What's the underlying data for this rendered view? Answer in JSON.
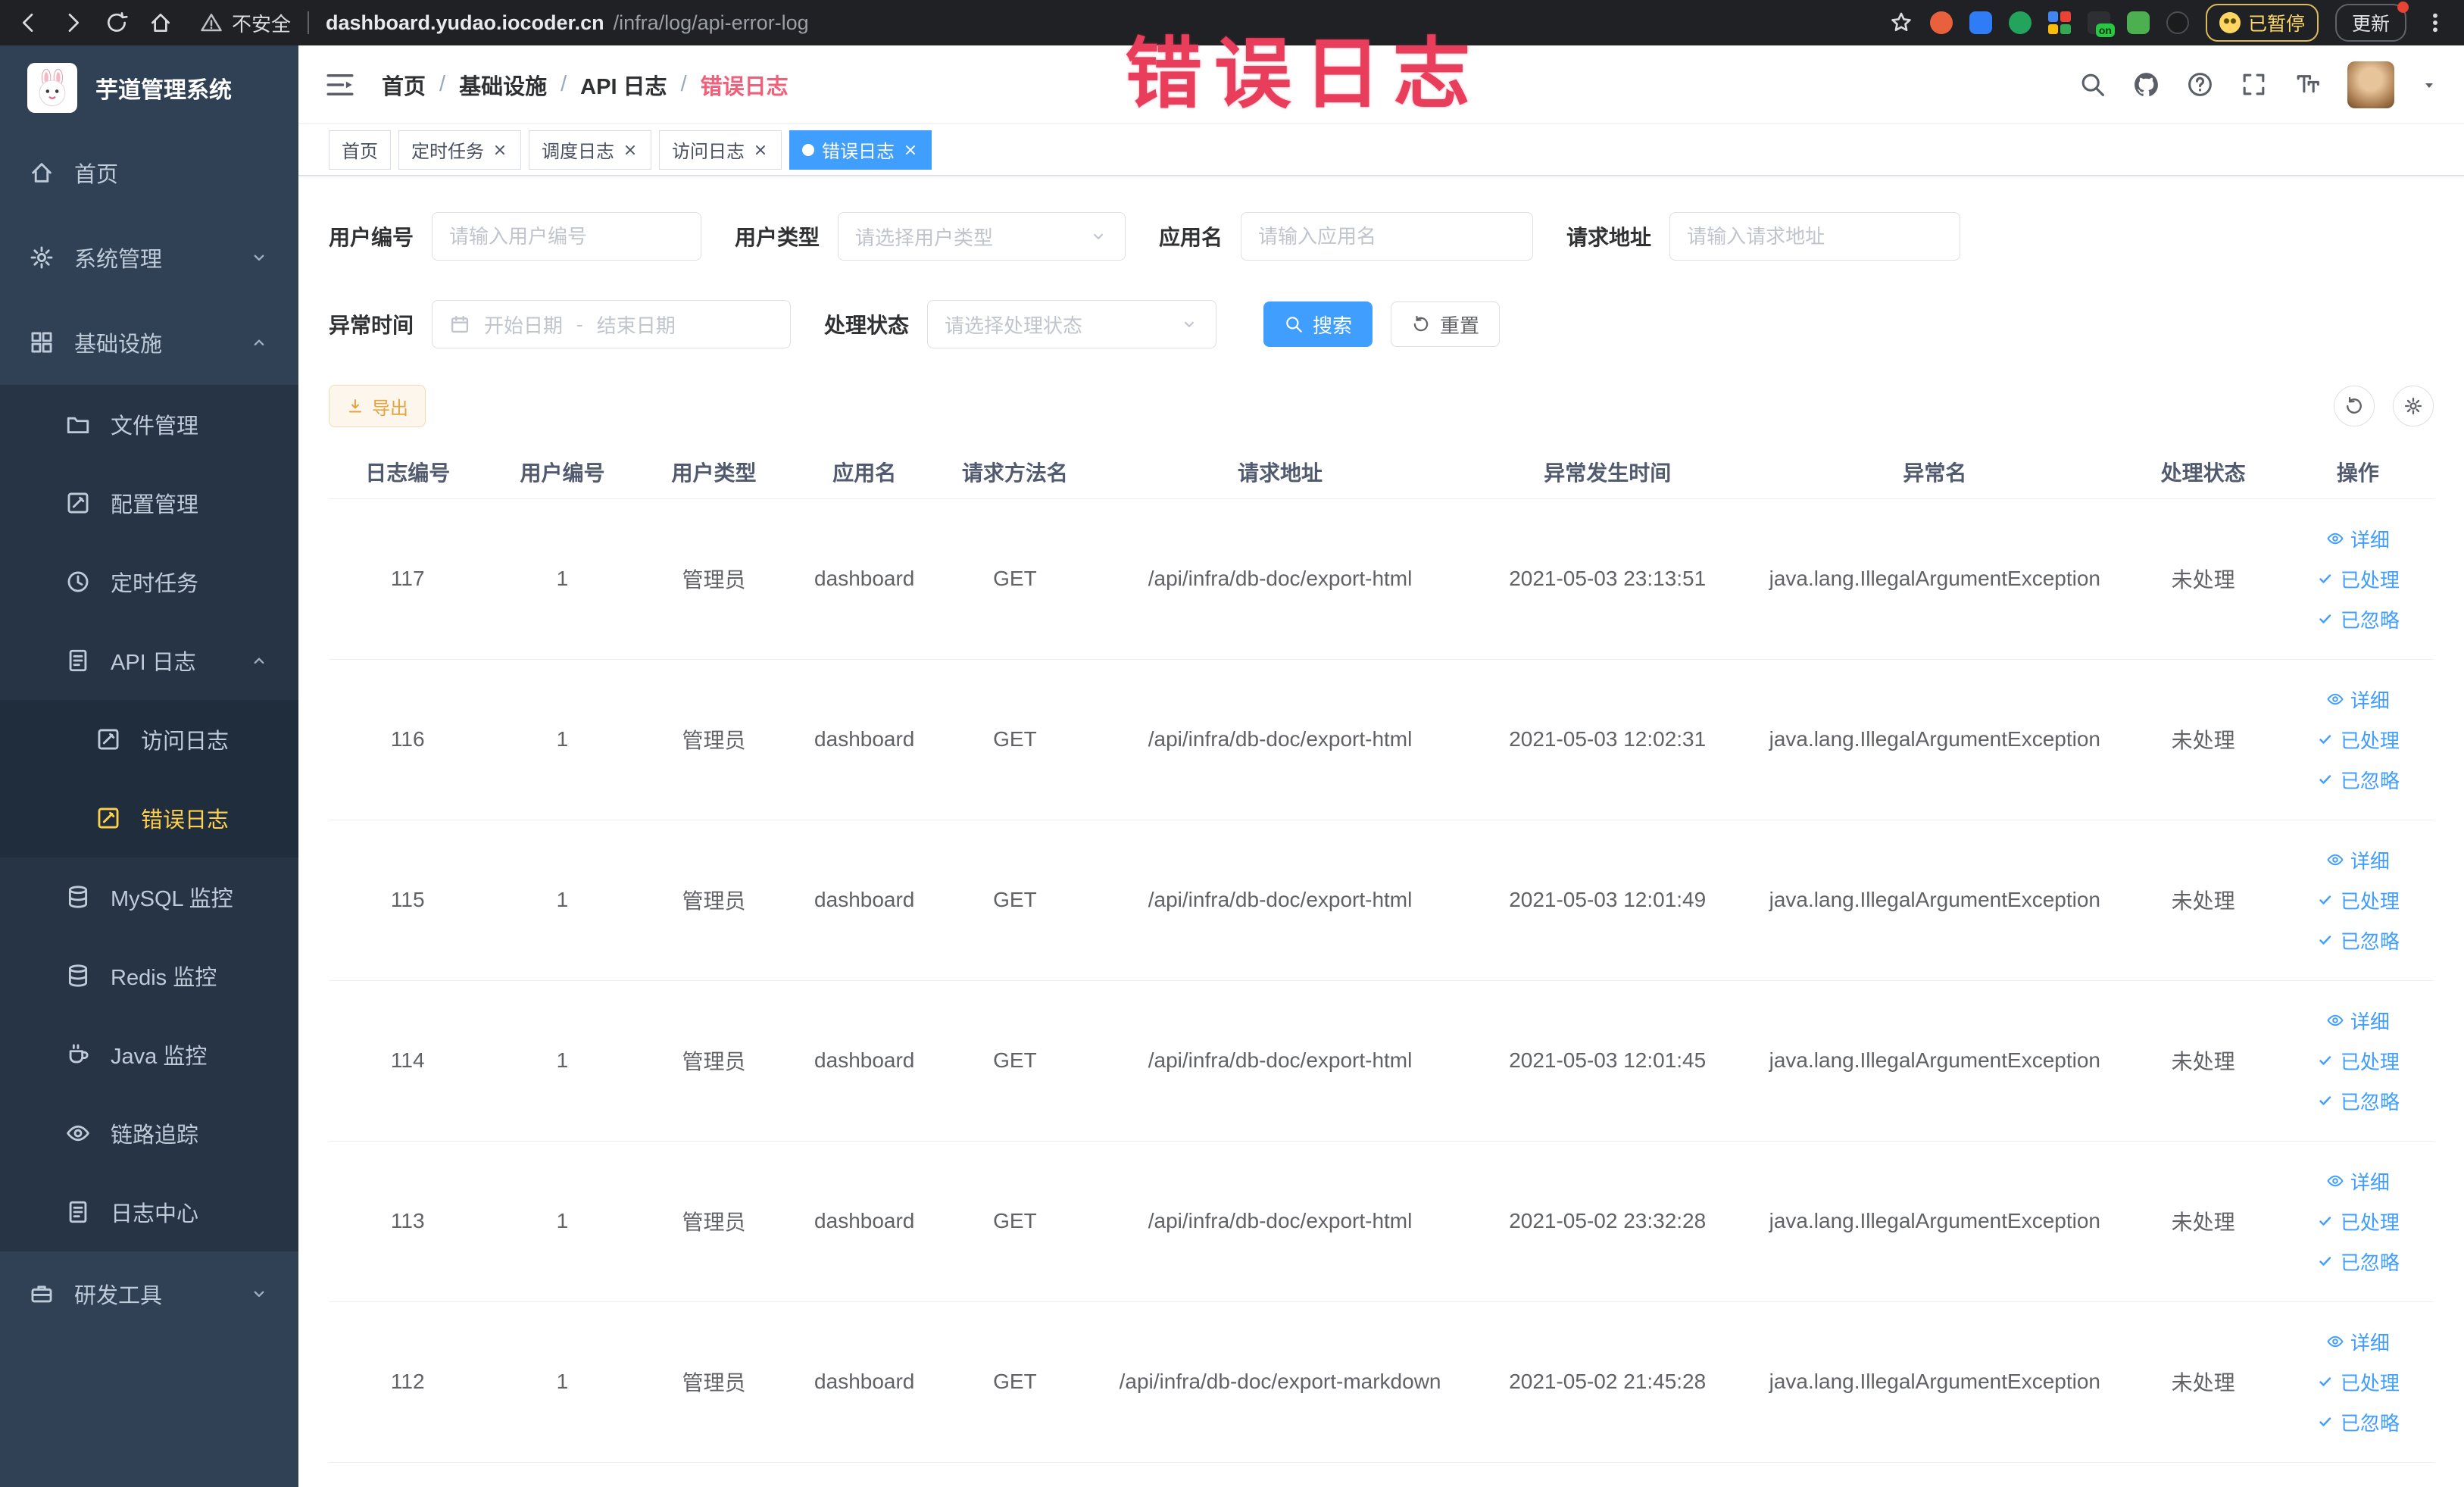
{
  "browser": {
    "security_warning": "不安全",
    "url_domain": "dashboard.yudao.iocoder.cn",
    "url_path": "/infra/log/api-error-log",
    "paused_badge": "已暂停",
    "update_button": "更新",
    "extension_badge": "on"
  },
  "annotation": "错误日志",
  "sidebar": {
    "app_title": "芋道管理系统",
    "menu": [
      {
        "label": "首页",
        "icon": "home-icon"
      },
      {
        "label": "系统管理",
        "icon": "gear-icon"
      },
      {
        "label": "基础设施",
        "icon": "grid-icon"
      },
      {
        "label": "文件管理",
        "icon": "folder-icon"
      },
      {
        "label": "配置管理",
        "icon": "edit-icon"
      },
      {
        "label": "定时任务",
        "icon": "clock-icon"
      },
      {
        "label": "API 日志",
        "icon": "document-icon"
      },
      {
        "label": "访问日志",
        "icon": "edit-icon"
      },
      {
        "label": "错误日志",
        "icon": "edit-icon"
      },
      {
        "label": "MySQL 监控",
        "icon": "database-icon"
      },
      {
        "label": "Redis 监控",
        "icon": "database-icon"
      },
      {
        "label": "Java 监控",
        "icon": "coffee-icon"
      },
      {
        "label": "链路追踪",
        "icon": "eye-icon"
      },
      {
        "label": "日志中心",
        "icon": "document-icon"
      },
      {
        "label": "研发工具",
        "icon": "toolbox-icon"
      }
    ]
  },
  "navbar": {
    "breadcrumb": [
      "首页",
      "基础设施",
      "API 日志",
      "错误日志"
    ]
  },
  "tabs": [
    {
      "label": "首页",
      "active": false,
      "closable": false
    },
    {
      "label": "定时任务",
      "active": false,
      "closable": true
    },
    {
      "label": "调度日志",
      "active": false,
      "closable": true
    },
    {
      "label": "访问日志",
      "active": false,
      "closable": true
    },
    {
      "label": "错误日志",
      "active": true,
      "closable": true
    }
  ],
  "filters": {
    "user_id_label": "用户编号",
    "user_id_placeholder": "请输入用户编号",
    "user_type_label": "用户类型",
    "user_type_placeholder": "请选择用户类型",
    "app_name_label": "应用名",
    "app_name_placeholder": "请输入应用名",
    "request_url_label": "请求地址",
    "request_url_placeholder": "请输入请求地址",
    "exception_time_label": "异常时间",
    "date_start_placeholder": "开始日期",
    "date_separator": "-",
    "date_end_placeholder": "结束日期",
    "process_status_label": "处理状态",
    "process_status_placeholder": "请选择处理状态",
    "search_button": "搜索",
    "reset_button": "重置"
  },
  "toolbar": {
    "export_button": "导出"
  },
  "table": {
    "headers": [
      "日志编号",
      "用户编号",
      "用户类型",
      "应用名",
      "请求方法名",
      "请求地址",
      "异常发生时间",
      "异常名",
      "处理状态",
      "操作"
    ],
    "action_detail": "详细",
    "action_processed": "已处理",
    "action_ignored": "已忽略",
    "rows": [
      {
        "log_id": "117",
        "user_id": "1",
        "user_type": "管理员",
        "app_name": "dashboard",
        "method": "GET",
        "url": "/api/infra/db-doc/export-html",
        "time": "2021-05-03 23:13:51",
        "exception": "java.lang.IllegalArgumentException",
        "status": "未处理"
      },
      {
        "log_id": "116",
        "user_id": "1",
        "user_type": "管理员",
        "app_name": "dashboard",
        "method": "GET",
        "url": "/api/infra/db-doc/export-html",
        "time": "2021-05-03 12:02:31",
        "exception": "java.lang.IllegalArgumentException",
        "status": "未处理"
      },
      {
        "log_id": "115",
        "user_id": "1",
        "user_type": "管理员",
        "app_name": "dashboard",
        "method": "GET",
        "url": "/api/infra/db-doc/export-html",
        "time": "2021-05-03 12:01:49",
        "exception": "java.lang.IllegalArgumentException",
        "status": "未处理"
      },
      {
        "log_id": "114",
        "user_id": "1",
        "user_type": "管理员",
        "app_name": "dashboard",
        "method": "GET",
        "url": "/api/infra/db-doc/export-html",
        "time": "2021-05-03 12:01:45",
        "exception": "java.lang.IllegalArgumentException",
        "status": "未处理"
      },
      {
        "log_id": "113",
        "user_id": "1",
        "user_type": "管理员",
        "app_name": "dashboard",
        "method": "GET",
        "url": "/api/infra/db-doc/export-html",
        "time": "2021-05-02 23:32:28",
        "exception": "java.lang.IllegalArgumentException",
        "status": "未处理"
      },
      {
        "log_id": "112",
        "user_id": "1",
        "user_type": "管理员",
        "app_name": "dashboard",
        "method": "GET",
        "url": "/api/infra/db-doc/export-markdown",
        "time": "2021-05-02 21:45:28",
        "exception": "java.lang.IllegalArgumentException",
        "status": "未处理"
      }
    ]
  },
  "colors": {
    "primary": "#409eff",
    "sidebar_bg": "#304156",
    "submenu_bg": "#263445",
    "active_menu_text": "#ffd04b",
    "annotation_red": "#e83e5c",
    "export_warning": "#e6a23c"
  }
}
